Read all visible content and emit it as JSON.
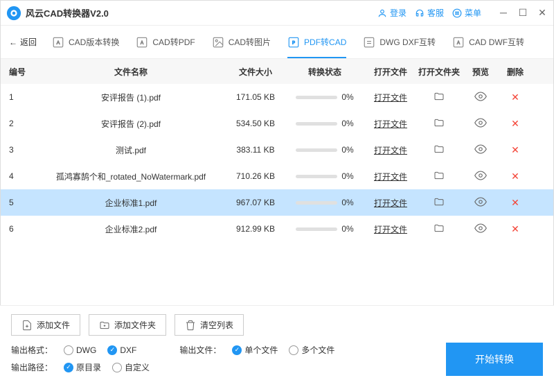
{
  "app": {
    "title": "风云CAD转换器V2.0"
  },
  "titlebar": {
    "login": "登录",
    "service": "客服",
    "menu": "菜单"
  },
  "toolbar": {
    "back": "返回",
    "tabs": [
      {
        "label": "CAD版本转换"
      },
      {
        "label": "CAD转PDF"
      },
      {
        "label": "CAD转图片"
      },
      {
        "label": "PDF转CAD"
      },
      {
        "label": "DWG DXF互转"
      },
      {
        "label": "CAD DWF互转"
      }
    ]
  },
  "table": {
    "headers": {
      "num": "编号",
      "name": "文件名称",
      "size": "文件大小",
      "status": "转换状态",
      "open": "打开文件",
      "folder": "打开文件夹",
      "preview": "预览",
      "delete": "删除"
    },
    "rows": [
      {
        "num": "1",
        "name": "安评报告 (1).pdf",
        "size": "171.05 KB",
        "percent": "0%",
        "open": "打开文件"
      },
      {
        "num": "2",
        "name": "安评报告 (2).pdf",
        "size": "534.50 KB",
        "percent": "0%",
        "open": "打开文件"
      },
      {
        "num": "3",
        "name": "测试.pdf",
        "size": "383.11 KB",
        "percent": "0%",
        "open": "打开文件"
      },
      {
        "num": "4",
        "name": "孤鸿寡鹄个和_rotated_NoWatermark.pdf",
        "size": "710.26 KB",
        "percent": "0%",
        "open": "打开文件"
      },
      {
        "num": "5",
        "name": "企业标准1.pdf",
        "size": "967.07 KB",
        "percent": "0%",
        "open": "打开文件",
        "selected": true
      },
      {
        "num": "6",
        "name": "企业标准2.pdf",
        "size": "912.99 KB",
        "percent": "0%",
        "open": "打开文件"
      }
    ]
  },
  "bottom": {
    "add_file": "添加文件",
    "add_folder": "添加文件夹",
    "clear_list": "清空列表",
    "output_format_label": "输出格式：",
    "format_dwg": "DWG",
    "format_dxf": "DXF",
    "output_file_label": "输出文件：",
    "single_file": "单个文件",
    "multi_file": "多个文件",
    "output_path_label": "输出路径：",
    "original_dir": "原目录",
    "custom": "自定义",
    "convert": "开始转换"
  }
}
